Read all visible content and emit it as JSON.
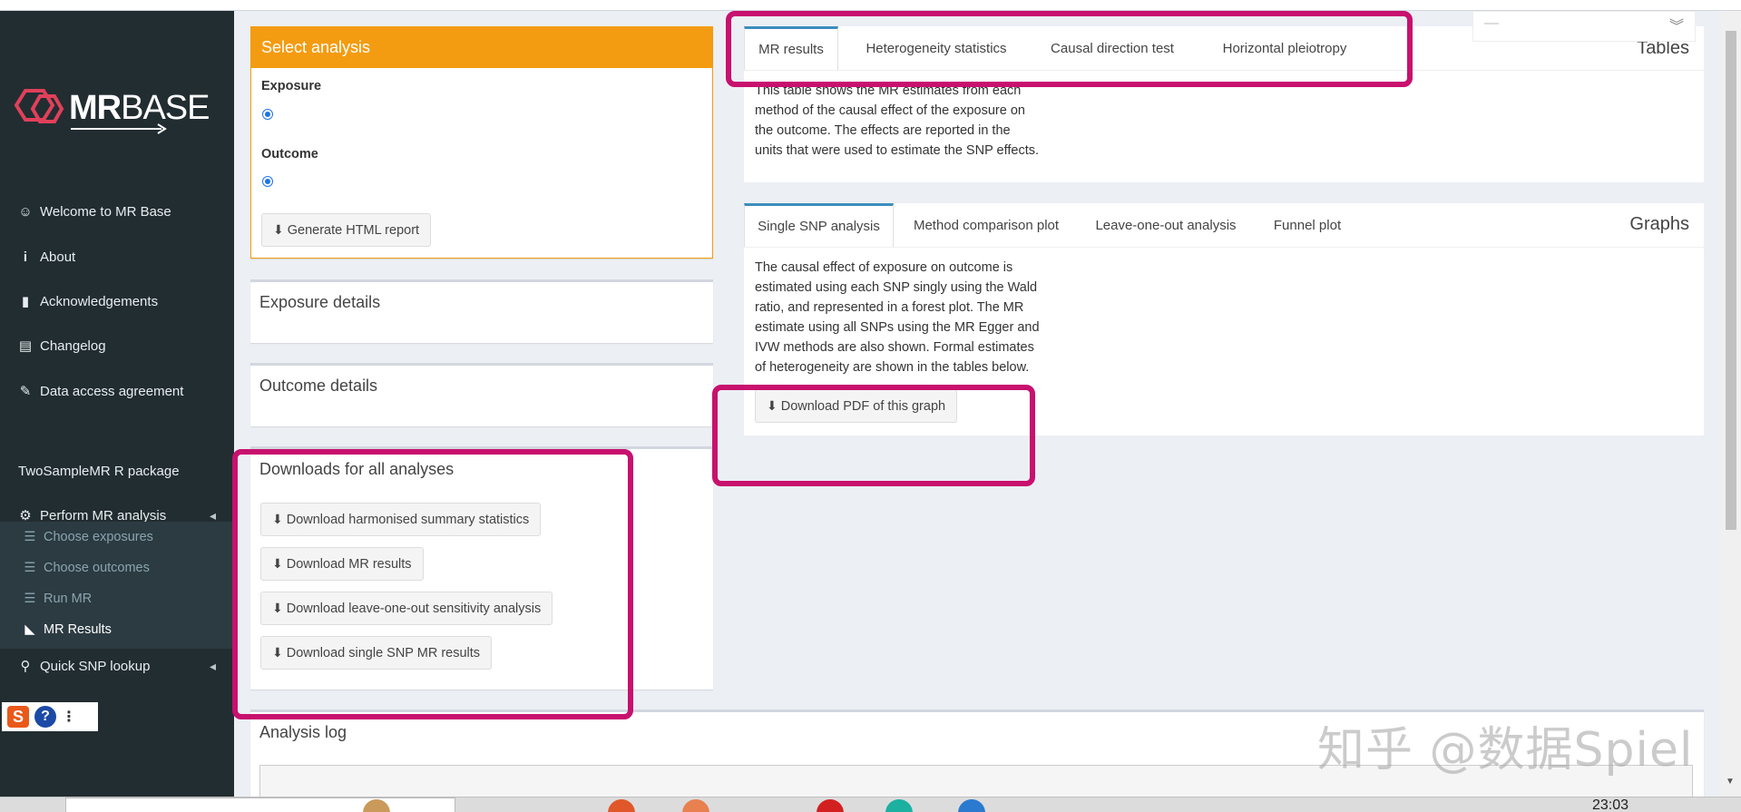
{
  "sidebar": {
    "logo": {
      "text_mr": "MR",
      "text_base": "BASE"
    },
    "items": [
      {
        "label": "Welcome to MR Base",
        "icon": "smile-icon"
      },
      {
        "label": "About",
        "icon": "info-icon"
      },
      {
        "label": "Acknowledgements",
        "icon": "book-icon"
      },
      {
        "label": "Changelog",
        "icon": "file-icon"
      },
      {
        "label": "Data access agreement",
        "icon": "gavel-icon"
      },
      {
        "label": "TwoSampleMR R package",
        "icon": ""
      },
      {
        "label": "Perform MR analysis",
        "icon": "cogs-icon"
      }
    ],
    "subitems": [
      {
        "label": "Choose exposures"
      },
      {
        "label": "Choose outcomes"
      },
      {
        "label": "Run MR"
      },
      {
        "label": "MR Results"
      }
    ],
    "quick_lookup": {
      "label": "Quick SNP lookup"
    },
    "extension": {
      "s": "S",
      "q": "?",
      "dots": "⋮"
    }
  },
  "select_analysis": {
    "title": "Select analysis",
    "exposure_label": "Exposure",
    "outcome_label": "Outcome",
    "report_button": "Generate HTML report"
  },
  "exposure_details": {
    "title": "Exposure details"
  },
  "outcome_details": {
    "title": "Outcome details"
  },
  "downloads": {
    "title": "Downloads for all analyses",
    "buttons": [
      "Download harmonised summary statistics",
      "Download MR results",
      "Download leave-one-out sensitivity analysis",
      "Download single SNP MR results"
    ]
  },
  "tables": {
    "label": "Tables",
    "tabs": [
      "MR results",
      "Heterogeneity statistics",
      "Causal direction test",
      "Horizontal pleiotropy"
    ],
    "description": [
      "This table shows the MR estimates from each",
      "method of the causal effect of the exposure on",
      "the outcome. The effects are reported in the",
      "units that were used to estimate the SNP effects."
    ]
  },
  "graphs": {
    "label": "Graphs",
    "tabs": [
      "Single SNP analysis",
      "Method comparison plot",
      "Leave-one-out analysis",
      "Funnel plot"
    ],
    "description": [
      "The causal effect of exposure on outcome is",
      "estimated using each SNP singly using the Wald",
      "ratio, and represented in a forest plot. The MR",
      "estimate using all SNPs using the MR Egger and",
      "IVW methods are also shown. Formal estimates",
      "of heterogeneity are shown in the tables below."
    ],
    "download_button": "Download PDF of this graph"
  },
  "analysis_log": {
    "title": "Analysis log"
  },
  "watermark": "知乎 @数据Spiel",
  "taskbar": {
    "clock": "23:03"
  },
  "colors": {
    "accent": "#f39c12",
    "highlight": "#c8106e",
    "sidebar_bg": "#222d32",
    "tab_active": "#3c8dbc"
  }
}
